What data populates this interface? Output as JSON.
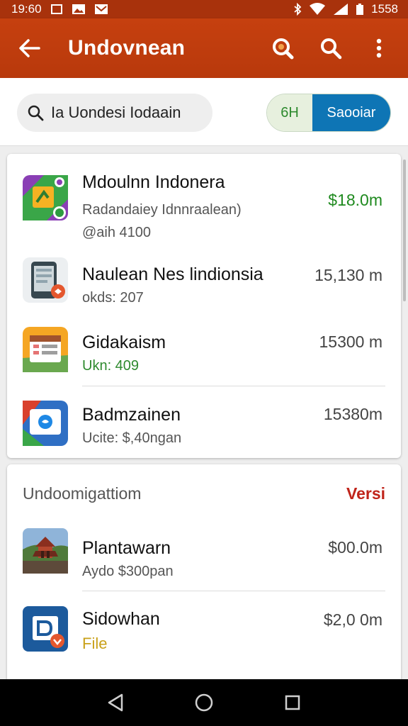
{
  "status_bar": {
    "time": "19:60",
    "battery": "1558"
  },
  "app_bar": {
    "title": "Undovnean"
  },
  "search": {
    "query": "Ia Uondesi Iodaain"
  },
  "segment": {
    "left": "6H",
    "right": "Saooiar"
  },
  "list1": [
    {
      "title": "Mdoulnn Indonera",
      "subtitle": "Radandaiey Idnnraalean)",
      "meta": "@aih 4100",
      "price": "$18.0m"
    },
    {
      "title": "Naulean Nes lindionsia",
      "subtitle": "okds: 207",
      "price": "15,130 m"
    },
    {
      "title": "Gidakaism",
      "subtitle": "Ukn: 409",
      "price": "15300 m"
    },
    {
      "title": "Badmzainen",
      "subtitle": "Ucite: $,40ngan",
      "price": "15380m"
    }
  ],
  "section2": {
    "title": "Undoomigattiom",
    "link": "Versi"
  },
  "list2": [
    {
      "title": "Plantawarn",
      "subtitle": "Aydo $300pan",
      "price": "$00.0m"
    },
    {
      "title": "Sidowhan",
      "subtitle": "File",
      "price": "$2,0 0m"
    }
  ],
  "colors": {
    "primary": "#c6400f",
    "accent_blue": "#0e75b5",
    "price_green": "#1f8a1f",
    "link_red": "#c0241a"
  }
}
